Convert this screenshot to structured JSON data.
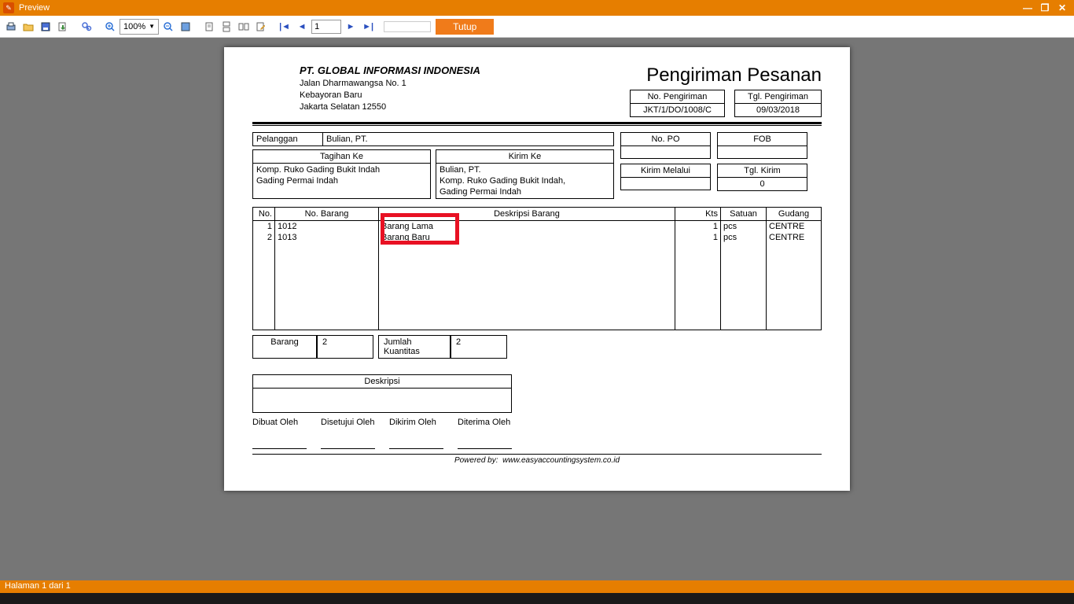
{
  "window": {
    "title": "Preview"
  },
  "toolbar": {
    "zoom": "100%",
    "page": "1",
    "close": "Tutup"
  },
  "status": {
    "text": "Halaman 1 dari 1"
  },
  "doc": {
    "company": {
      "name": "PT. GLOBAL INFORMASI INDONESIA",
      "addr1": "Jalan Dharmawangsa No. 1",
      "addr2": "Kebayoran Baru",
      "addr3": "Jakarta Selatan 12550"
    },
    "title": "Pengiriman Pesanan",
    "meta": {
      "no_label": "No. Pengiriman",
      "tgl_label": "Tgl. Pengiriman",
      "no_value": "JKT/1/DO/1008/C",
      "tgl_value": "09/03/2018"
    },
    "customer": {
      "label": "Pelanggan",
      "value": "Bulian, PT."
    },
    "bill": {
      "label": "Tagihan Ke",
      "line1": "Komp. Ruko Gading Bukit Indah",
      "line2": "Gading Permai Indah"
    },
    "ship": {
      "label": "Kirim Ke",
      "line1": "Bulian, PT.",
      "line2": "Komp. Ruko Gading Bukit Indah,",
      "line3": "Gading Permai Indah"
    },
    "po": {
      "label": "No. PO",
      "value": ""
    },
    "fob": {
      "label": "FOB",
      "value": ""
    },
    "via": {
      "label": "Kirim Melalui",
      "value": ""
    },
    "shipdate": {
      "label": "Tgl. Kirim",
      "value": "0"
    },
    "columns": {
      "no": "No.",
      "code": "No. Barang",
      "desc": "Deskripsi Barang",
      "qty": "Kts",
      "unit": "Satuan",
      "wh": "Gudang"
    },
    "items": [
      {
        "no": "1",
        "code": "1012",
        "desc": "Barang Lama",
        "qty": "1",
        "unit": "pcs",
        "wh": "CENTRE"
      },
      {
        "no": "2",
        "code": "1013",
        "desc": "Barang Baru",
        "qty": "1",
        "unit": "pcs",
        "wh": "CENTRE"
      }
    ],
    "summary": {
      "barang_label": "Barang",
      "barang_value": "2",
      "qty_label": "Jumlah Kuantitas",
      "qty_value": "2"
    },
    "desc_label": "Deskripsi",
    "signs": {
      "s1": "Dibuat Oleh",
      "s2": "Disetujui Oleh",
      "s3": "Dikirim Oleh",
      "s4": "Diterima Oleh"
    },
    "footer": {
      "label": "Powered by:",
      "url": "www.easyaccountingsystem.co.id"
    }
  }
}
